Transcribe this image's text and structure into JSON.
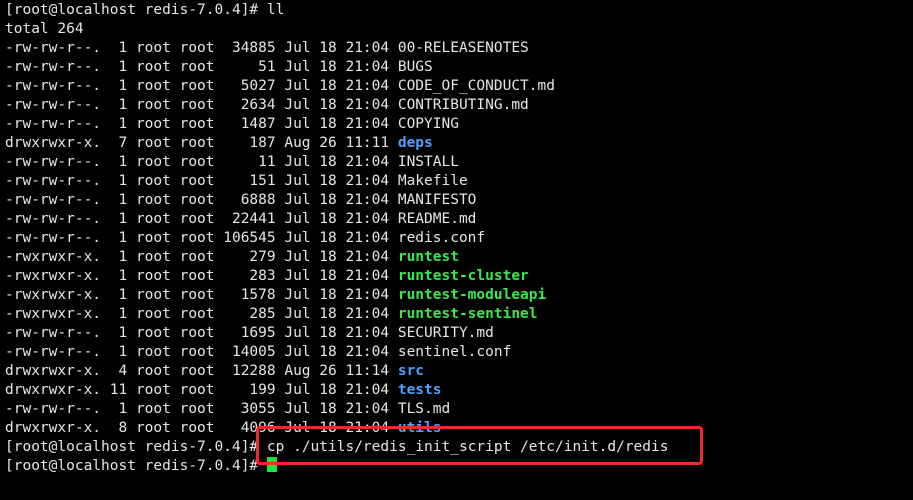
{
  "terminal": {
    "prompt_first": "[root@localhost redis-7.0.4]# ",
    "command_first": "ll",
    "total_line": "total 264",
    "entries": [
      {
        "meta": "-rw-rw-r--.  1 root root  34885 Jul 18 21:04 ",
        "name": "00-RELEASENOTES",
        "kind": "file"
      },
      {
        "meta": "-rw-rw-r--.  1 root root     51 Jul 18 21:04 ",
        "name": "BUGS",
        "kind": "file"
      },
      {
        "meta": "-rw-rw-r--.  1 root root   5027 Jul 18 21:04 ",
        "name": "CODE_OF_CONDUCT.md",
        "kind": "file"
      },
      {
        "meta": "-rw-rw-r--.  1 root root   2634 Jul 18 21:04 ",
        "name": "CONTRIBUTING.md",
        "kind": "file"
      },
      {
        "meta": "-rw-rw-r--.  1 root root   1487 Jul 18 21:04 ",
        "name": "COPYING",
        "kind": "file"
      },
      {
        "meta": "drwxrwxr-x.  7 root root    187 Aug 26 11:11 ",
        "name": "deps",
        "kind": "dir"
      },
      {
        "meta": "-rw-rw-r--.  1 root root     11 Jul 18 21:04 ",
        "name": "INSTALL",
        "kind": "file"
      },
      {
        "meta": "-rw-rw-r--.  1 root root    151 Jul 18 21:04 ",
        "name": "Makefile",
        "kind": "file"
      },
      {
        "meta": "-rw-rw-r--.  1 root root   6888 Jul 18 21:04 ",
        "name": "MANIFESTO",
        "kind": "file"
      },
      {
        "meta": "-rw-rw-r--.  1 root root  22441 Jul 18 21:04 ",
        "name": "README.md",
        "kind": "file"
      },
      {
        "meta": "-rw-rw-r--.  1 root root 106545 Jul 18 21:04 ",
        "name": "redis.conf",
        "kind": "file"
      },
      {
        "meta": "-rwxrwxr-x.  1 root root    279 Jul 18 21:04 ",
        "name": "runtest",
        "kind": "exe"
      },
      {
        "meta": "-rwxrwxr-x.  1 root root    283 Jul 18 21:04 ",
        "name": "runtest-cluster",
        "kind": "exe"
      },
      {
        "meta": "-rwxrwxr-x.  1 root root   1578 Jul 18 21:04 ",
        "name": "runtest-moduleapi",
        "kind": "exe"
      },
      {
        "meta": "-rwxrwxr-x.  1 root root    285 Jul 18 21:04 ",
        "name": "runtest-sentinel",
        "kind": "exe"
      },
      {
        "meta": "-rw-rw-r--.  1 root root   1695 Jul 18 21:04 ",
        "name": "SECURITY.md",
        "kind": "file"
      },
      {
        "meta": "-rw-rw-r--.  1 root root  14005 Jul 18 21:04 ",
        "name": "sentinel.conf",
        "kind": "file"
      },
      {
        "meta": "drwxrwxr-x.  4 root root  12288 Aug 26 11:14 ",
        "name": "src",
        "kind": "dir"
      },
      {
        "meta": "drwxrwxr-x. 11 root root    199 Jul 18 21:04 ",
        "name": "tests",
        "kind": "dir"
      },
      {
        "meta": "-rw-rw-r--.  1 root root   3055 Jul 18 21:04 ",
        "name": "TLS.md",
        "kind": "file"
      },
      {
        "meta": "drwxrwxr-x.  8 root root   4096 Jul 18 21:04 ",
        "name": "utils",
        "kind": "dir"
      }
    ],
    "prompt_second": "[root@localhost redis-7.0.4]# ",
    "command_second": "cp ./utils/redis_init_script /etc/init.d/redis",
    "prompt_third": "[root@localhost redis-7.0.4]# ",
    "colors": {
      "background": "#000000",
      "text": "#e6e6e6",
      "directory": "#4aa3ff",
      "executable": "#39e84a",
      "cursor": "#1ee33a",
      "highlight_box": "#ee2a2a"
    }
  }
}
